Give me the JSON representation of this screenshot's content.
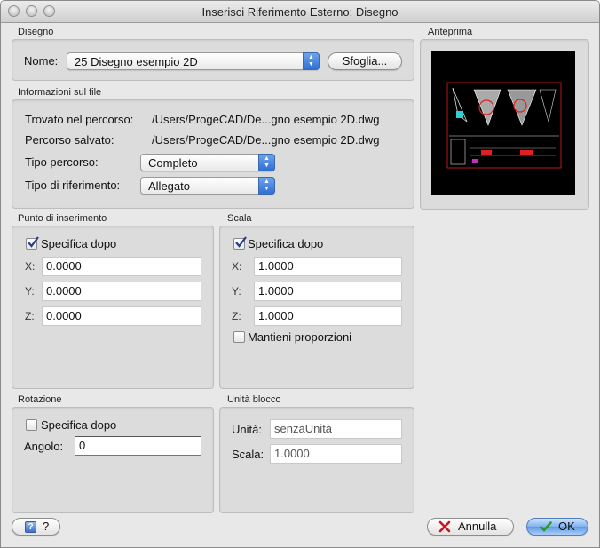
{
  "window": {
    "title": "Inserisci Riferimento Esterno: Disegno"
  },
  "disegno": {
    "group_label": "Disegno",
    "name_label": "Nome:",
    "name_value": "25 Disegno esempio 2D",
    "browse_label": "Sfoglia..."
  },
  "preview": {
    "group_label": "Anteprima"
  },
  "file_info": {
    "group_label": "Informazioni sul file",
    "found_path_label": "Trovato nel percorso:",
    "found_path_value": "/Users/ProgeCAD/De...gno esempio 2D.dwg",
    "saved_path_label": "Percorso salvato:",
    "saved_path_value": "/Users/ProgeCAD/De...gno esempio 2D.dwg",
    "path_type_label": "Tipo percorso:",
    "path_type_value": "Completo",
    "ref_type_label": "Tipo di riferimento:",
    "ref_type_value": "Allegato"
  },
  "insertion": {
    "group_label": "Punto di inserimento",
    "specify_later_label": "Specifica dopo",
    "specify_later_checked": true,
    "x_label": "X:",
    "x_value": "0.0000",
    "y_label": "Y:",
    "y_value": "0.0000",
    "z_label": "Z:",
    "z_value": "0.0000"
  },
  "scale": {
    "group_label": "Scala",
    "specify_later_label": "Specifica dopo",
    "specify_later_checked": true,
    "x_label": "X:",
    "x_value": "1.0000",
    "y_label": "Y:",
    "y_value": "1.0000",
    "z_label": "Z:",
    "z_value": "1.0000",
    "keep_proportions_label": "Mantieni proporzioni",
    "keep_proportions_checked": false
  },
  "rotation": {
    "group_label": "Rotazione",
    "specify_later_label": "Specifica dopo",
    "specify_later_checked": false,
    "angle_label": "Angolo:",
    "angle_value": "0"
  },
  "block_unit": {
    "group_label": "Unità blocco",
    "unit_label": "Unità:",
    "unit_value": "senzaUnità",
    "scale_label": "Scala:",
    "scale_value": "1.0000"
  },
  "footer": {
    "help_label": "?",
    "cancel_label": "Annulla",
    "ok_label": "OK"
  },
  "colors": {
    "accent_blue": "#3a7be0",
    "cancel_red": "#d0101c",
    "ok_green": "#2a9b2a"
  }
}
